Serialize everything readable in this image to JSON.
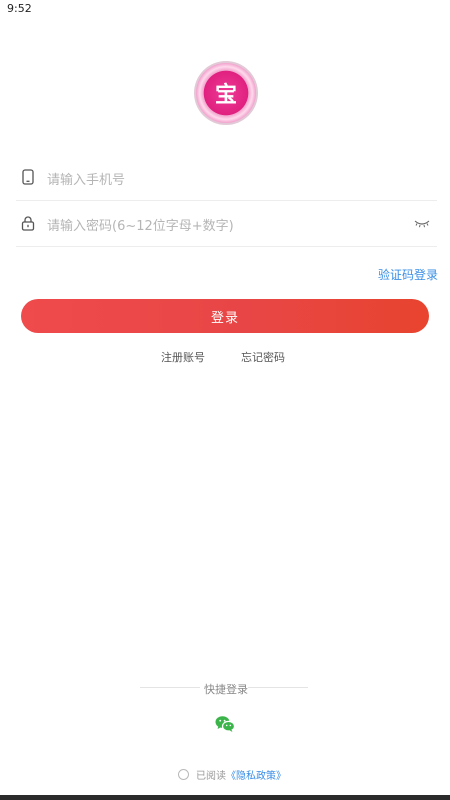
{
  "status_bar": {
    "time": "9:52"
  },
  "logo": {
    "char": "宝"
  },
  "form": {
    "phone_placeholder": "请输入手机号",
    "password_placeholder": "请输入密码(6~12位字母+数字)",
    "sms_login_label": "验证码登录",
    "login_button": "登录"
  },
  "links": {
    "register": "注册账号",
    "forgot": "忘记密码"
  },
  "quick_login": {
    "label": "快捷登录",
    "wechat_icon": "wechat-icon"
  },
  "privacy": {
    "prefix": "已阅读",
    "link": "《隐私政策》"
  },
  "colors": {
    "primary_gradient_start": "#ef4a4c",
    "primary_gradient_end": "#e8442f",
    "link": "#3a8ee6",
    "wechat": "#3bb54a"
  }
}
